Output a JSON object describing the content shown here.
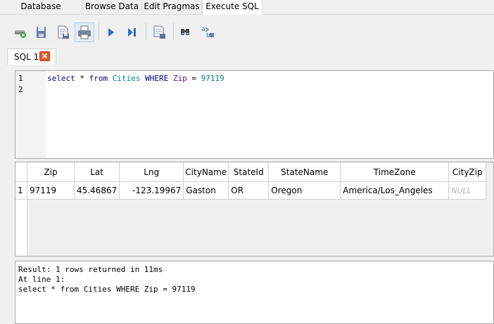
{
  "tabs": [
    {
      "label": "Database Structure",
      "active": false
    },
    {
      "label": "Browse Data",
      "active": false
    },
    {
      "label": "Edit Pragmas",
      "active": false
    },
    {
      "label": "Execute SQL",
      "active": true
    }
  ],
  "toolbar": {
    "icons": [
      "open-tab-icon",
      "open-sql-file-icon",
      "save-sql-file-icon",
      "print-icon",
      "execute-all-icon",
      "execute-current-line-icon",
      "save-results-icon",
      "find-icon",
      "find-replace-icon"
    ]
  },
  "editor_tab": {
    "label": "SQL 1",
    "close": "×"
  },
  "editor": {
    "line_numbers": [
      "1",
      "2"
    ],
    "sql_tokens": {
      "kw1": "select",
      "star": "*",
      "kw2": "from",
      "table": "Cities",
      "kw3": "WHERE",
      "column": "Zip",
      "eq": "=",
      "value": "97119"
    }
  },
  "grid": {
    "columns": [
      "Zip",
      "Lat",
      "Lng",
      "CityName",
      "StateId",
      "StateName",
      "TimeZone",
      "CityZip"
    ],
    "rows": [
      {
        "num": "1",
        "cells": [
          "97119",
          "45.46867",
          "-123.19967",
          "Gaston",
          "OR",
          "Oregon",
          "America/Los_Angeles",
          "NULL"
        ]
      }
    ]
  },
  "message": {
    "lines": [
      "Result: 1 rows returned in 11ms",
      "At line 1:",
      "select * from Cities WHERE Zip = 97119"
    ]
  }
}
